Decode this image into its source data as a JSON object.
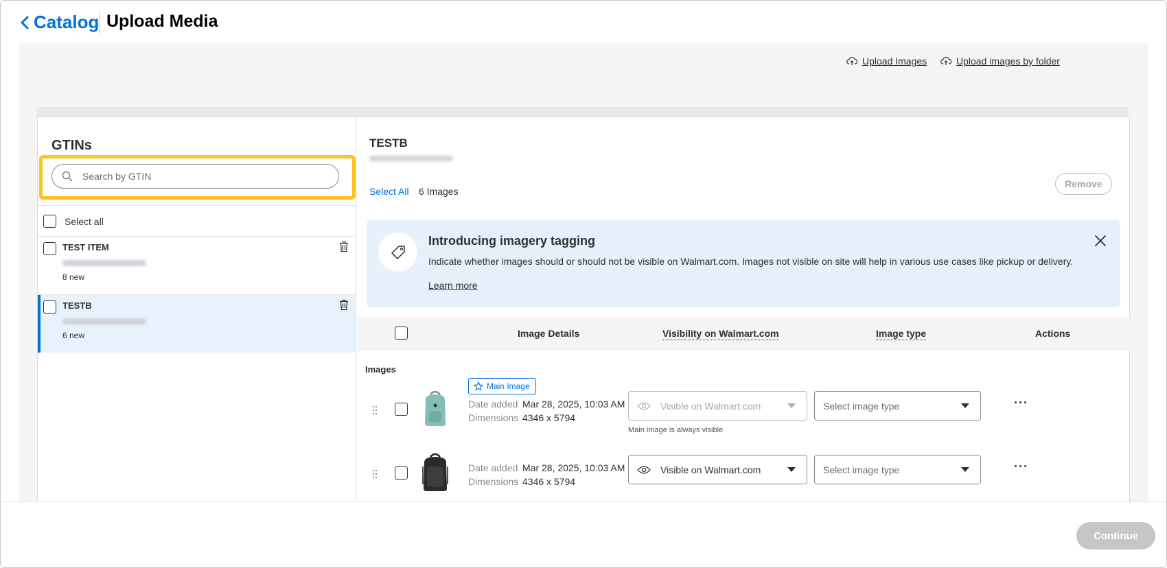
{
  "header": {
    "back_label": "Catalog",
    "title": "Upload Media"
  },
  "toolbar": {
    "upload_images": "Upload Images",
    "upload_by_folder": "Upload images by folder"
  },
  "left_panel": {
    "title": "GTINs",
    "search_placeholder": "Search by GTIN",
    "select_all": "Select all",
    "items": [
      {
        "name": "TEST ITEM",
        "new_count": "8 new",
        "selected": false
      },
      {
        "name": "TESTB",
        "new_count": "6 new",
        "selected": true
      }
    ]
  },
  "detail": {
    "name": "TESTB",
    "select_all": "Select All",
    "image_count": "6 Images",
    "remove_label": "Remove",
    "banner": {
      "title": "Introducing imagery tagging",
      "text": "Indicate whether images should or should not be visible on Walmart.com. Images not visible on site will help in various use cases like pickup or delivery.",
      "learn_more": "Learn more"
    },
    "columns": {
      "details": "Image Details",
      "visibility": "Visibility on Walmart.com",
      "type": "Image type",
      "actions": "Actions"
    },
    "section_label": "Images",
    "rows": [
      {
        "badge": "Main Image",
        "date_label": "Date added",
        "date_value": "Mar 28, 2025, 10:03 AM",
        "dim_label": "Dimensions",
        "dim_value": "4346 x 5794",
        "visibility": "Visible on Walmart.com",
        "visibility_note": "Main image is always visible",
        "type_placeholder": "Select image type",
        "actions": "···"
      },
      {
        "date_label": "Date added",
        "date_value": "Mar 28, 2025, 10:03 AM",
        "dim_label": "Dimensions",
        "dim_value": "4346 x 5794",
        "visibility": "Visible on Walmart.com",
        "type_placeholder": "Select image type",
        "actions": "···"
      }
    ]
  },
  "footer": {
    "continue_label": "Continue"
  },
  "colors": {
    "brand_blue": "#0071dc",
    "highlight": "#ffc220",
    "banner_bg": "#e5f0fa",
    "selected_row_bg": "#e8f2fc"
  }
}
